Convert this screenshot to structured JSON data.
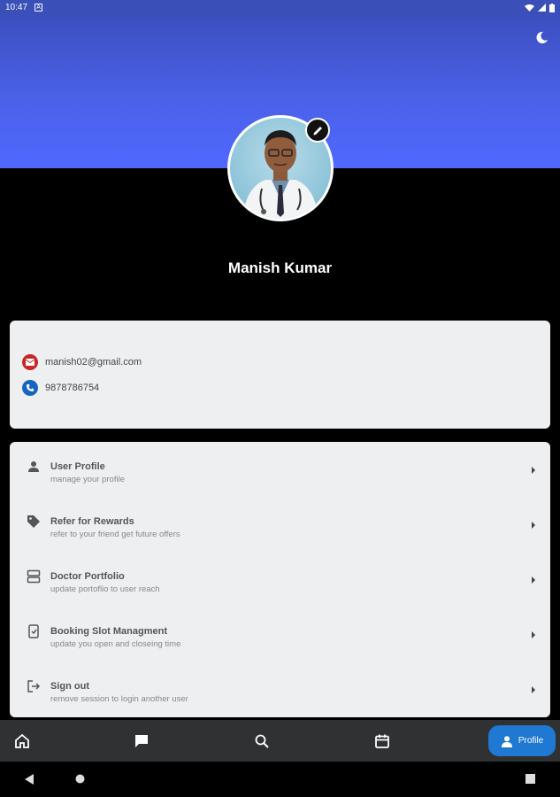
{
  "status_bar": {
    "time": "10:47",
    "sim_glyph": "A"
  },
  "header": {
    "accent_color": "#4a61e8",
    "theme_icon": "moon-icon"
  },
  "profile": {
    "name": "Manish Kumar",
    "edit_icon": "pencil-icon"
  },
  "contact": {
    "email": "manish02@gmail.com",
    "phone": "9878786754",
    "email_icon_color": "#c62828",
    "phone_icon_color": "#1565c0"
  },
  "menu": [
    {
      "icon": "person-icon",
      "title": "User Profile",
      "subtitle": "manage your profile"
    },
    {
      "icon": "tag-icon",
      "title": "Refer for Rewards",
      "subtitle": "refer to your friend get future offers"
    },
    {
      "icon": "server-icon",
      "title": "Doctor Portfolio",
      "subtitle": "update portoflio to user reach"
    },
    {
      "icon": "booking-icon",
      "title": "Booking Slot Managment",
      "subtitle": "update you open and closeing time"
    },
    {
      "icon": "logout-icon",
      "title": "Sign out",
      "subtitle": "remove session to login another user"
    }
  ],
  "bottom_nav": {
    "items": [
      "home-icon",
      "chat-icon",
      "search-icon",
      "calendar-icon"
    ],
    "active_label": "Profile",
    "active_color": "#1f78d1"
  }
}
